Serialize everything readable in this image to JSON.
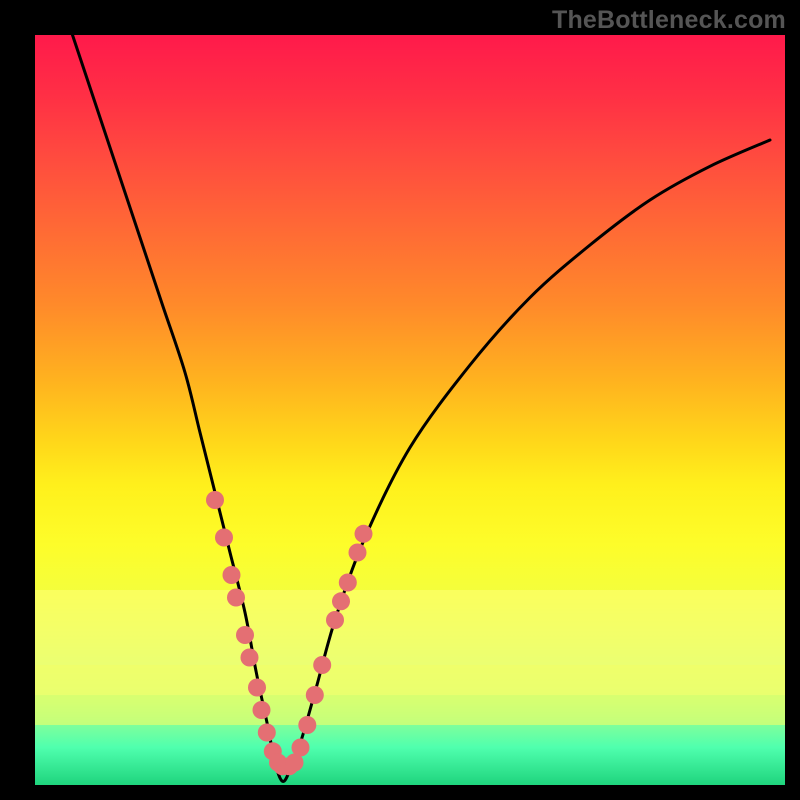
{
  "watermark": "TheBottleneck.com",
  "chart_data": {
    "type": "line",
    "title": "",
    "xlabel": "",
    "ylabel": "",
    "xlim": [
      0,
      100
    ],
    "ylim": [
      0,
      100
    ],
    "description": "Bottleneck percentage curve. Y represents bottleneck percent (100 at top, 0 at bottom). Background gradient encodes severity: red high, green low. Curve is V-shaped with minimum near x≈33. Pink markers cluster on both arms in the 5–30% band near the dip.",
    "series": [
      {
        "name": "bottleneck-curve",
        "x": [
          5,
          8,
          11,
          14,
          17,
          20,
          22,
          24,
          26,
          28,
          29.5,
          31,
          32,
          33,
          34,
          35.5,
          37.5,
          40,
          44,
          50,
          58,
          66,
          74,
          82,
          90,
          98
        ],
        "y": [
          100,
          91,
          82,
          73,
          64,
          55,
          47,
          39,
          31,
          23,
          15,
          8,
          3,
          0.5,
          2,
          6,
          13,
          22,
          33,
          45,
          56,
          65,
          72,
          78,
          82.5,
          86
        ]
      }
    ],
    "markers": {
      "name": "highlight-dots",
      "color": "#e46f73",
      "radius_px": 9,
      "points": [
        {
          "x": 24.0,
          "y": 38
        },
        {
          "x": 25.2,
          "y": 33
        },
        {
          "x": 26.2,
          "y": 28
        },
        {
          "x": 26.8,
          "y": 25
        },
        {
          "x": 28.0,
          "y": 20
        },
        {
          "x": 28.6,
          "y": 17
        },
        {
          "x": 29.6,
          "y": 13
        },
        {
          "x": 30.2,
          "y": 10
        },
        {
          "x": 30.9,
          "y": 7
        },
        {
          "x": 31.7,
          "y": 4.5
        },
        {
          "x": 32.4,
          "y": 3
        },
        {
          "x": 33.0,
          "y": 2.5
        },
        {
          "x": 33.9,
          "y": 2.5
        },
        {
          "x": 34.6,
          "y": 3
        },
        {
          "x": 35.4,
          "y": 5
        },
        {
          "x": 36.3,
          "y": 8
        },
        {
          "x": 37.3,
          "y": 12
        },
        {
          "x": 38.3,
          "y": 16
        },
        {
          "x": 40.0,
          "y": 22
        },
        {
          "x": 40.8,
          "y": 24.5
        },
        {
          "x": 41.7,
          "y": 27
        },
        {
          "x": 43.0,
          "y": 31
        },
        {
          "x": 43.8,
          "y": 33.5
        }
      ]
    },
    "gradient_stops": [
      {
        "pct": 0,
        "color": "#ff1a4b"
      },
      {
        "pct": 25,
        "color": "#ff6a35"
      },
      {
        "pct": 50,
        "color": "#ffd61a"
      },
      {
        "pct": 75,
        "color": "#e4ff55"
      },
      {
        "pct": 100,
        "color": "#1fd47d"
      }
    ]
  }
}
